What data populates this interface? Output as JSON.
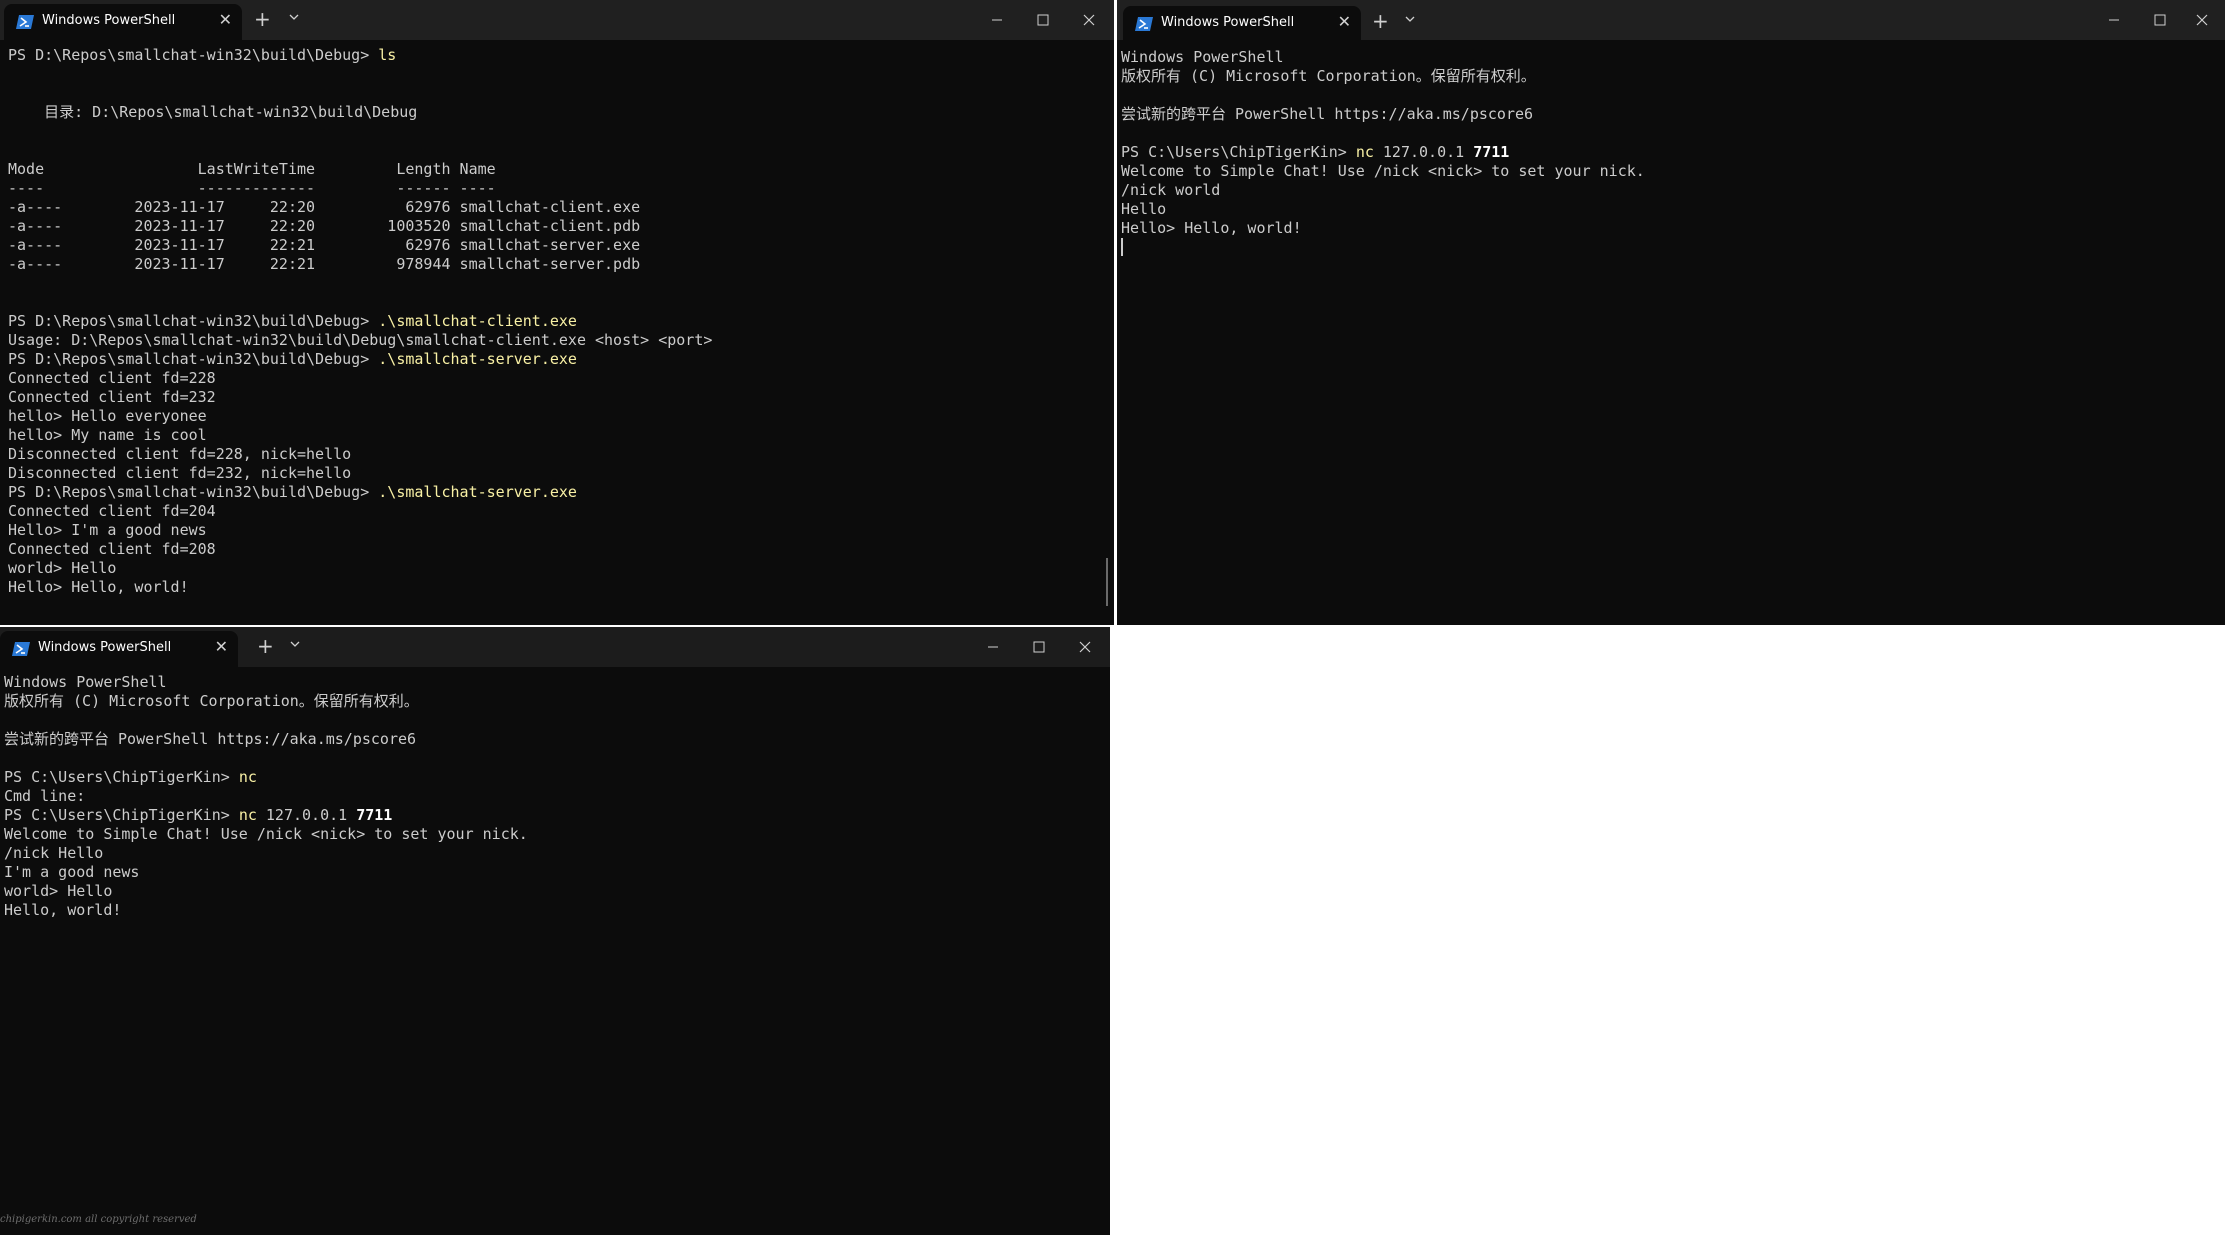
{
  "tab_title": "Windows PowerShell",
  "icons": {
    "app": "powershell-icon",
    "new_tab": "plus-icon",
    "dropdown": "chevron-down-icon",
    "minimize": "minimize-icon",
    "maximize": "maximize-icon",
    "close": "close-icon"
  },
  "glyphs": {
    "close": "✕",
    "new_tab": "+"
  },
  "colors": {
    "background": "#0c0c0c",
    "titlebar": "#202020",
    "text": "#cccccc",
    "command": "#f9f1a5",
    "accent": "#1f6feb"
  },
  "window1": {
    "lines": [
      {
        "text": "PS D:\\Repos\\smallchat-win32\\build\\Debug> ",
        "cmd": "ls"
      },
      {
        "text": ""
      },
      {
        "text": ""
      },
      {
        "text": "    目录: D:\\Repos\\smallchat-win32\\build\\Debug"
      },
      {
        "text": ""
      },
      {
        "text": ""
      },
      {
        "text": "Mode                 LastWriteTime         Length Name"
      },
      {
        "text": "----                 -------------         ------ ----"
      },
      {
        "text": "-a----        2023-11-17     22:20          62976 smallchat-client.exe"
      },
      {
        "text": "-a----        2023-11-17     22:20        1003520 smallchat-client.pdb"
      },
      {
        "text": "-a----        2023-11-17     22:21          62976 smallchat-server.exe"
      },
      {
        "text": "-a----        2023-11-17     22:21         978944 smallchat-server.pdb"
      },
      {
        "text": ""
      },
      {
        "text": ""
      },
      {
        "text": "PS D:\\Repos\\smallchat-win32\\build\\Debug> ",
        "cmd": ".\\smallchat-client.exe"
      },
      {
        "text": "Usage: D:\\Repos\\smallchat-win32\\build\\Debug\\smallchat-client.exe <host> <port>"
      },
      {
        "text": "PS D:\\Repos\\smallchat-win32\\build\\Debug> ",
        "cmd": ".\\smallchat-server.exe"
      },
      {
        "text": "Connected client fd=228"
      },
      {
        "text": "Connected client fd=232"
      },
      {
        "text": "hello> Hello everyonee"
      },
      {
        "text": "hello> My name is cool"
      },
      {
        "text": "Disconnected client fd=228, nick=hello"
      },
      {
        "text": "Disconnected client fd=232, nick=hello"
      },
      {
        "text": "PS D:\\Repos\\smallchat-win32\\build\\Debug> ",
        "cmd": ".\\smallchat-server.exe"
      },
      {
        "text": "Connected client fd=204"
      },
      {
        "text": "Hello> I'm a good news"
      },
      {
        "text": "Connected client fd=208"
      },
      {
        "text": "world> Hello"
      },
      {
        "text": "Hello> Hello, world!"
      }
    ]
  },
  "window2": {
    "lines": [
      {
        "text": "Windows PowerShell"
      },
      {
        "text": "版权所有 (C) Microsoft Corporation。保留所有权利。"
      },
      {
        "text": ""
      },
      {
        "text": "尝试新的跨平台 PowerShell https://aka.ms/pscore6"
      },
      {
        "text": ""
      },
      {
        "text": "PS C:\\Users\\ChipTigerKin> ",
        "cmd": "nc",
        "rest": " 127.0.0.1 ",
        "num": "7711"
      },
      {
        "text": "Welcome to Simple Chat! Use /nick <nick> to set your nick."
      },
      {
        "text": "/nick world"
      },
      {
        "text": "Hello"
      },
      {
        "text": "Hello> Hello, world!"
      }
    ]
  },
  "window3": {
    "lines": [
      {
        "text": "Windows PowerShell"
      },
      {
        "text": "版权所有 (C) Microsoft Corporation。保留所有权利。"
      },
      {
        "text": ""
      },
      {
        "text": "尝试新的跨平台 PowerShell https://aka.ms/pscore6"
      },
      {
        "text": ""
      },
      {
        "text": "PS C:\\Users\\ChipTigerKin> ",
        "cmd": "nc"
      },
      {
        "text": "Cmd line:"
      },
      {
        "text": "PS C:\\Users\\ChipTigerKin> ",
        "cmd": "nc",
        "rest": " 127.0.0.1 ",
        "num": "7711"
      },
      {
        "text": "Welcome to Simple Chat! Use /nick <nick> to set your nick."
      },
      {
        "text": "/nick Hello"
      },
      {
        "text": "I'm a good news"
      },
      {
        "text": "world> Hello"
      },
      {
        "text": "Hello, world!"
      }
    ]
  },
  "watermark": "chipigerkin.com all copyright reserved"
}
